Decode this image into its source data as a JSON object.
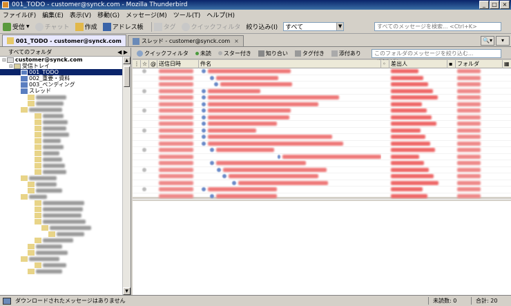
{
  "window": {
    "title": "001_TODO - customer@synck.com - Mozilla Thunderbird"
  },
  "menu": [
    "ファイル(F)",
    "編集(E)",
    "表示(V)",
    "移動(G)",
    "メッセージ(M)",
    "ツール(T)",
    "ヘルプ(H)"
  ],
  "toolbar": {
    "get": "受信",
    "chat": "チャット",
    "write": "作成",
    "address": "アドレス帳",
    "tag": "タグ",
    "quickfilter": "クイックフィルタ",
    "filter_label": "絞り込み(I)",
    "filter_value": "すべて",
    "search_placeholder": "すべてのメッセージを検索... <Ctrl+K>"
  },
  "tabs": [
    {
      "label": "001_TODO - customer@synck.com",
      "active": true
    },
    {
      "label": "スレッド - customer@synck.com",
      "active": false
    }
  ],
  "folderpane": {
    "header": "すべてのフォルダ",
    "account": "customer@synck.com",
    "inbox": "受信トレイ",
    "folders": [
      "001_TODO",
      "002_重要・資料",
      "003_ペンディング",
      "スレッド"
    ]
  },
  "quickfilter": {
    "items": [
      "クイックフィルタ",
      "未読",
      "スター付き",
      "知り合い",
      "タグ付き",
      "添付あり"
    ],
    "search_placeholder": "このフォルダのメッセージを絞り込む... <Ctrl+F>"
  },
  "columns": {
    "date": "送信日時",
    "subject": "件名",
    "sender": "差出人",
    "folder": "フォルダ"
  },
  "status": {
    "message": "ダウンロードされたメッセージはありません",
    "unread": "未読数: 0",
    "total": "合計: 20"
  }
}
